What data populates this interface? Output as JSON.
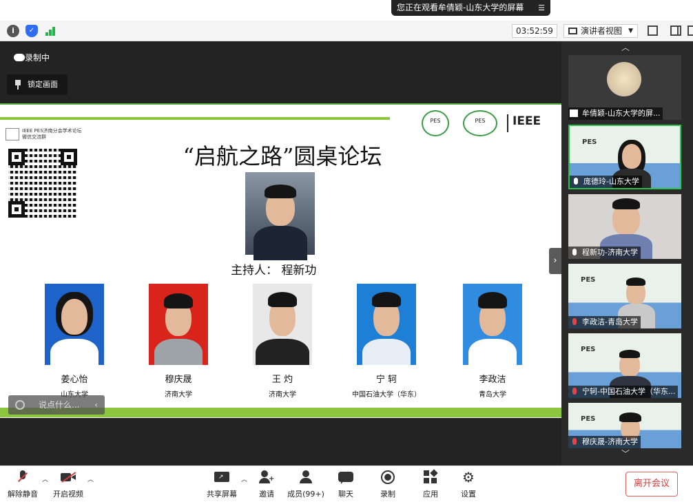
{
  "banner": {
    "text": "您正在观看牟倩颖-山东大学的屏幕",
    "menu_icon": "menu-lines-icon"
  },
  "toolbar": {
    "timer": "03:52:59",
    "view_label": "演讲者视图"
  },
  "stage": {
    "recording_label": "录制中",
    "lock_label": "锁定画面",
    "chat_placeholder": "说点什么..."
  },
  "slide": {
    "org_label_line1": "IEEE PES济南分会学术论坛",
    "org_label_line2": "微信交流群",
    "logo1": "PES",
    "logo2": "PES",
    "logo3": "IEEE",
    "title": "“启航之路”圆桌论坛",
    "host_label": "主持人： 程新功",
    "panelists": [
      {
        "name": "姜心怡",
        "org": "山东大学"
      },
      {
        "name": "穆庆晟",
        "org": "济南大学"
      },
      {
        "name": "王 灼",
        "org": "济南大学"
      },
      {
        "name": "宁 轲",
        "org": "中国石油大学（华东）"
      },
      {
        "name": "李政洁",
        "org": "青岛大学"
      }
    ]
  },
  "videos": [
    {
      "name": "牟倩颖-山东大学的屏...",
      "muted": true,
      "sharing": true
    },
    {
      "name": "庞德玲-山东大学",
      "muted": false,
      "active": true
    },
    {
      "name": "程新功-济南大学",
      "muted": false
    },
    {
      "name": "李政洁-青岛大学",
      "muted": true
    },
    {
      "name": "宁轲-中国石油大学（华东...",
      "muted": true
    },
    {
      "name": "穆庆晟-济南大学",
      "muted": true
    }
  ],
  "controls": {
    "mute": "解除静音",
    "video": "开启视频",
    "share": "共享屏幕",
    "invite": "邀请",
    "members": "成员(99+)",
    "chat": "聊天",
    "record": "录制",
    "apps": "应用",
    "settings": "设置",
    "leave": "离开会议"
  },
  "colors": {
    "accent_green": "#8cc63f",
    "active_border": "#2ec14a",
    "leave_red": "#d83c3c"
  }
}
